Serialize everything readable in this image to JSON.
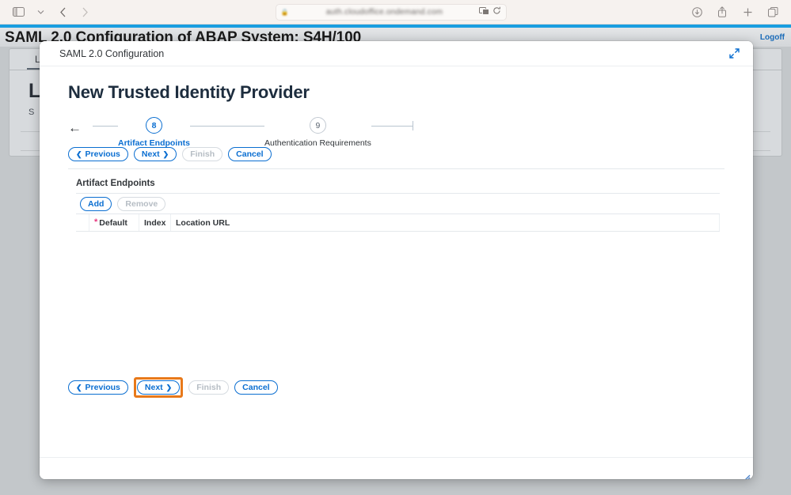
{
  "browser": {
    "url_text": "auth.cloudoffice.ondemand.com",
    "icons": {
      "sidebar": "sidebar-toggle-icon",
      "chevron": "chevron-down-icon",
      "back": "back-arrow-icon",
      "forward": "forward-arrow-icon",
      "lock": "lock-icon",
      "reader": "reader-view-icon",
      "reload": "reload-icon",
      "download": "download-icon",
      "share": "share-icon",
      "new_tab": "plus-icon",
      "tab_overview": "tab-overview-icon"
    }
  },
  "app": {
    "title": "SAML 2.0 Configuration of ABAP System: S4H/100",
    "logoff": "Logoff",
    "background": {
      "tab_label": "L",
      "heading": "L",
      "subtitle": "S"
    }
  },
  "dialog": {
    "header_title": "SAML 2.0 Configuration",
    "expand_icon": "expand-icon",
    "resize_icon": "resize-grip-icon",
    "page_title": "New Trusted Identity Provider"
  },
  "wizard": {
    "back_icon": "back-arrow-icon",
    "steps": [
      {
        "number": "8",
        "label": "Artifact Endpoints",
        "state": "active"
      },
      {
        "number": "9",
        "label": "Authentication Requirements",
        "state": "inactive"
      }
    ]
  },
  "nav_buttons": {
    "previous": "Previous",
    "next": "Next",
    "finish": "Finish",
    "cancel": "Cancel",
    "previous_chevron": "❮",
    "next_chevron": "❯"
  },
  "section": {
    "title": "Artifact Endpoints",
    "toolbar": {
      "add": "Add",
      "remove": "Remove"
    },
    "table": {
      "required_marker": "*",
      "columns": [
        "Default",
        "Index",
        "Location URL"
      ],
      "rows": []
    }
  },
  "colors": {
    "accent_blue": "#0a6ed1",
    "header_accent": "#1a9ee0",
    "required_pink": "#e8387f",
    "highlight_orange": "#e8791a",
    "disabled_gray": "#b6bdc4"
  }
}
